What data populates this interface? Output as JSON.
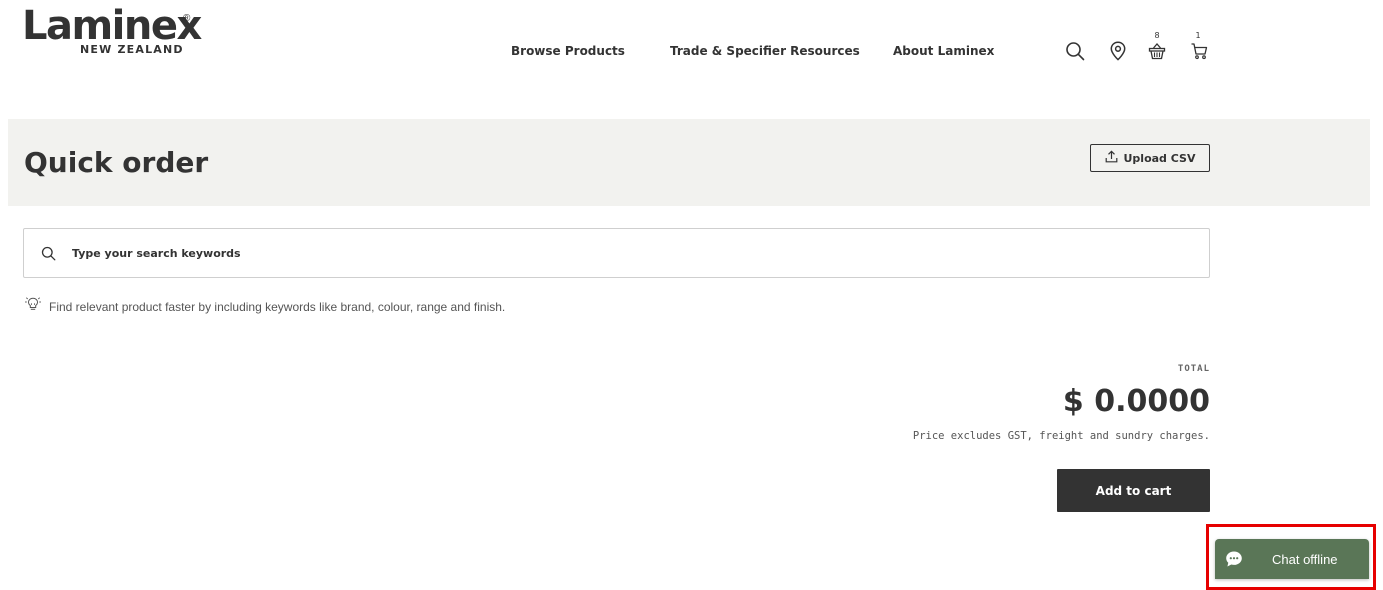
{
  "brand": {
    "wordmark": "Laminex",
    "registered": "®",
    "region": "NEW ZEALAND"
  },
  "nav": {
    "items": [
      {
        "label": "Browse Products"
      },
      {
        "label": "Trade & Specifier Resources"
      },
      {
        "label": "About Laminex"
      }
    ]
  },
  "header_icons": {
    "search": "search-icon",
    "location": "location-pin-icon",
    "basket": "basket-icon",
    "basket_count": "8",
    "cart": "cart-icon",
    "cart_count": "1"
  },
  "page": {
    "title": "Quick order",
    "upload_label": "Upload CSV",
    "upload_icon": "upload-icon"
  },
  "search": {
    "placeholder": "Type your search keywords",
    "value": "",
    "hint": "Find relevant product faster by including keywords like brand, colour, range and finish.",
    "hint_icon": "lightbulb-icon"
  },
  "totals": {
    "label": "TOTAL",
    "value": "$ 0.0000",
    "note": "Price excludes GST, freight and sundry charges."
  },
  "actions": {
    "add_to_cart": "Add to cart"
  },
  "chat": {
    "label": "Chat offline",
    "icon": "chat-bubble-icon"
  },
  "colors": {
    "text": "#333333",
    "banner_bg": "#f2f2ef",
    "button_dark": "#333333",
    "chat_green": "#5a7657",
    "highlight_red": "#e60000"
  }
}
